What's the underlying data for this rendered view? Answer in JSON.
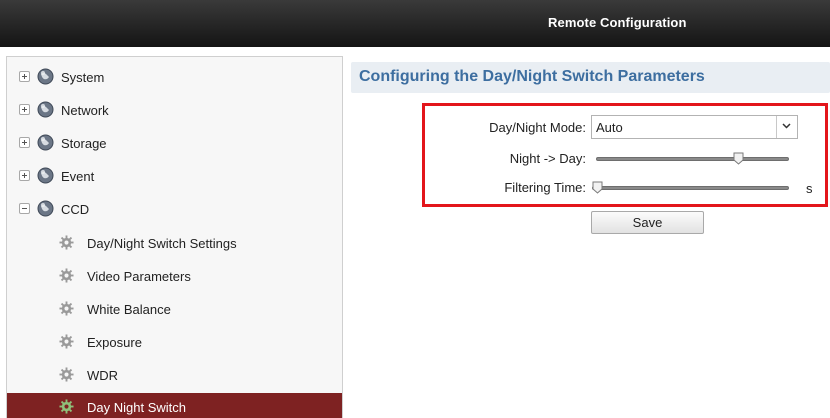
{
  "window": {
    "title": "Remote Configuration"
  },
  "sidebar": {
    "items": [
      {
        "label": "System",
        "icon": "globe-icon",
        "expander": "plus"
      },
      {
        "label": "Network",
        "icon": "globe-icon",
        "expander": "plus"
      },
      {
        "label": "Storage",
        "icon": "globe-icon",
        "expander": "plus"
      },
      {
        "label": "Event",
        "icon": "globe-icon",
        "expander": "plus"
      },
      {
        "label": "CCD",
        "icon": "globe-icon",
        "expander": "minus"
      },
      {
        "label": "Day/Night Switch Settings",
        "icon": "gear-icon"
      },
      {
        "label": "Video Parameters",
        "icon": "gear-icon"
      },
      {
        "label": "White Balance",
        "icon": "gear-icon"
      },
      {
        "label": "Exposure",
        "icon": "gear-icon"
      },
      {
        "label": "WDR",
        "icon": "gear-icon"
      },
      {
        "label": "Day Night Switch",
        "icon": "gear-icon",
        "selected": true
      }
    ]
  },
  "main": {
    "title": "Configuring the Day/Night Switch Parameters",
    "mode": {
      "label": "Day/Night Mode:",
      "value": "Auto"
    },
    "night_to_day": {
      "label": "Night -> Day:",
      "level": 0.75
    },
    "filtering": {
      "label": "Filtering Time:",
      "level": 0.0,
      "unit": "s"
    },
    "save_label": "Save"
  },
  "colors": {
    "selected_bg": "#7e2222",
    "title_text": "#3d6ea0",
    "highlight_border": "#e3161b"
  }
}
